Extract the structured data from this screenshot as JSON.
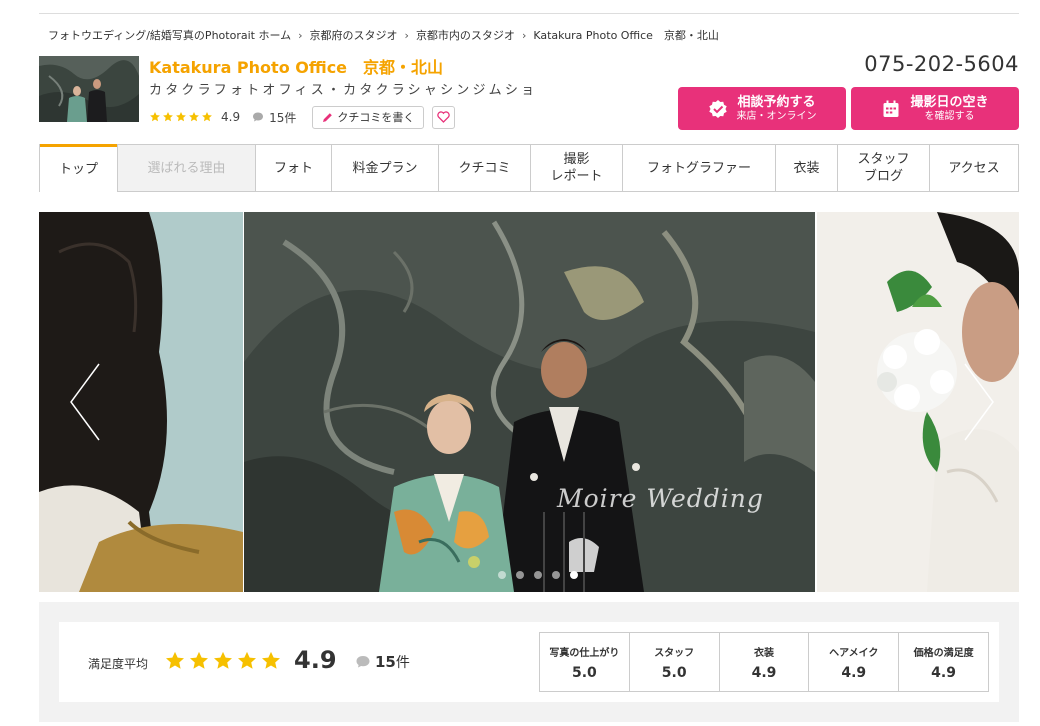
{
  "breadcrumb": [
    {
      "label": "フォトウエディング/結婚写真のPhotorait ホーム"
    },
    {
      "label": "京都府のスタジオ"
    },
    {
      "label": "京都市内のスタジオ"
    },
    {
      "label": "Katakura Photo Office　京都・北山"
    }
  ],
  "studio": {
    "name": "Katakura Photo Office　京都・北山",
    "kana": "カタクラフォトオフィス・カタクラシャシンジムショ",
    "rating": "4.9",
    "stars": 5,
    "review_count": "15件",
    "write_review_label": "クチコミを書く",
    "phone": "075-202-5604"
  },
  "cta": {
    "consult_main": "相談予約する",
    "consult_sub": "来店・オンライン",
    "availability_main": "撮影日の空き",
    "availability_sub": "を確認する"
  },
  "tabs": [
    {
      "label": "トップ",
      "state": "active"
    },
    {
      "label": "選ばれる理由",
      "state": "disabled"
    },
    {
      "label": "フォト",
      "state": "normal"
    },
    {
      "label": "料金プラン",
      "state": "normal"
    },
    {
      "label": "クチコミ",
      "state": "normal"
    },
    {
      "label": "撮影\nレポート",
      "state": "normal"
    },
    {
      "label": "フォトグラファー",
      "state": "normal"
    },
    {
      "label": "衣装",
      "state": "normal"
    },
    {
      "label": "スタッフ\nブログ",
      "state": "normal"
    },
    {
      "label": "アクセス",
      "state": "normal"
    }
  ],
  "slider": {
    "watermark": "Moire Wedding",
    "dot_count": 5,
    "active_dot": 4
  },
  "summary": {
    "label": "満足度平均",
    "stars": 5,
    "score": "4.9",
    "count": "15",
    "count_unit": "件",
    "categories": [
      {
        "label": "写真の仕上がり",
        "value": "5.0"
      },
      {
        "label": "スタッフ",
        "value": "5.0"
      },
      {
        "label": "衣装",
        "value": "4.9"
      },
      {
        "label": "ヘアメイク",
        "value": "4.9"
      },
      {
        "label": "価格の満足度",
        "value": "4.9"
      }
    ]
  },
  "colors": {
    "brand_orange": "#f5a300",
    "cta_pink": "#e8317a",
    "star_yellow": "#f6c000"
  }
}
